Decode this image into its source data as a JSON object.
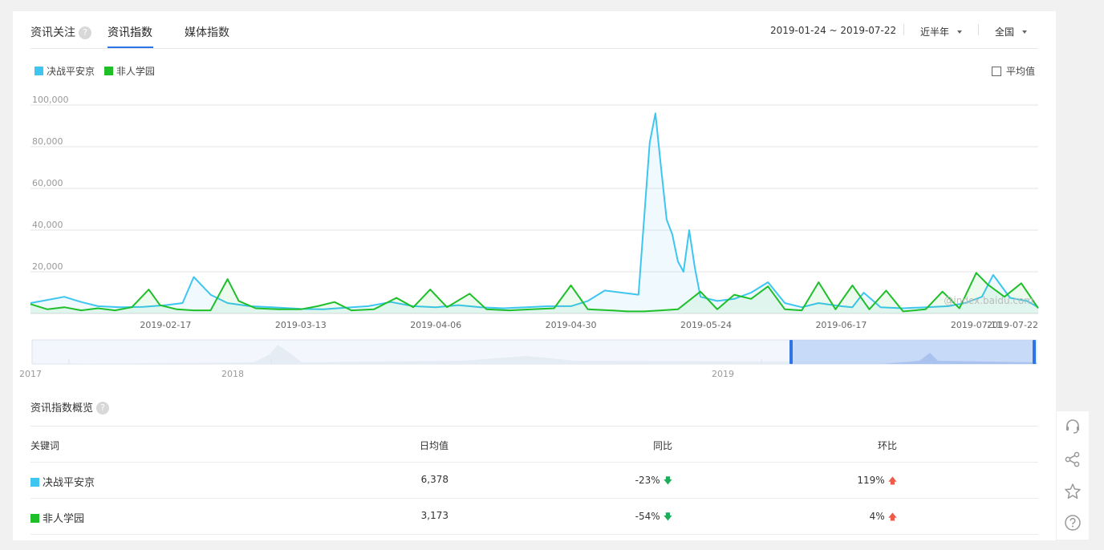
{
  "header": {
    "title": "资讯关注",
    "help_glyph": "?",
    "tabs": [
      {
        "label": "资讯指数",
        "active": true
      },
      {
        "label": "媒体指数",
        "active": false
      }
    ],
    "date_range": "2019-01-24 ~ 2019-07-22",
    "period": "近半年",
    "region": "全国"
  },
  "legend": {
    "series": [
      {
        "name": "决战平安京",
        "color": "#3ec5f0"
      },
      {
        "name": "非人学园",
        "color": "#1fbf2a"
      }
    ],
    "average_label": "平均值"
  },
  "watermark": "@index.baidu.com",
  "chart_data": {
    "type": "line",
    "x": [
      "2019-02-17",
      "2019-03-13",
      "2019-04-06",
      "2019-04-30",
      "2019-05-24",
      "2019-06-17",
      "2019-07-11",
      "2019-07-22"
    ],
    "ylim": [
      0,
      100000
    ],
    "yticks": [
      "100,000",
      "80,000",
      "60,000",
      "40,000",
      "20,000"
    ],
    "ytick_values": [
      100000,
      80000,
      60000,
      40000,
      20000
    ],
    "xstart": "2019-01-24",
    "xend": "2019-07-22",
    "series": [
      {
        "name": "决战平安京",
        "color": "#3ec5f0",
        "points": [
          [
            "2019-01-24",
            5000
          ],
          [
            "2019-01-27",
            6500
          ],
          [
            "2019-01-30",
            8000
          ],
          [
            "2019-02-02",
            5500
          ],
          [
            "2019-02-05",
            3500
          ],
          [
            "2019-02-09",
            3000
          ],
          [
            "2019-02-13",
            3200
          ],
          [
            "2019-02-17",
            4000
          ],
          [
            "2019-02-20",
            5000
          ],
          [
            "2019-02-22",
            17500
          ],
          [
            "2019-02-25",
            9000
          ],
          [
            "2019-02-28",
            5000
          ],
          [
            "2019-03-04",
            3500
          ],
          [
            "2019-03-08",
            3000
          ],
          [
            "2019-03-13",
            2200
          ],
          [
            "2019-03-17",
            2000
          ],
          [
            "2019-03-21",
            2800
          ],
          [
            "2019-03-25",
            3500
          ],
          [
            "2019-03-29",
            5500
          ],
          [
            "2019-04-02",
            3500
          ],
          [
            "2019-04-06",
            3000
          ],
          [
            "2019-04-10",
            4000
          ],
          [
            "2019-04-14",
            3000
          ],
          [
            "2019-04-18",
            2500
          ],
          [
            "2019-04-22",
            3000
          ],
          [
            "2019-04-26",
            3500
          ],
          [
            "2019-04-30",
            3500
          ],
          [
            "2019-05-03",
            6000
          ],
          [
            "2019-05-06",
            11000
          ],
          [
            "2019-05-09",
            10000
          ],
          [
            "2019-05-12",
            9000
          ],
          [
            "2019-05-14",
            82000
          ],
          [
            "2019-05-15",
            96000
          ],
          [
            "2019-05-16",
            70000
          ],
          [
            "2019-05-17",
            45000
          ],
          [
            "2019-05-18",
            38000
          ],
          [
            "2019-05-19",
            25000
          ],
          [
            "2019-05-20",
            20000
          ],
          [
            "2019-05-21",
            40000
          ],
          [
            "2019-05-22",
            22000
          ],
          [
            "2019-05-23",
            8000
          ],
          [
            "2019-05-26",
            6000
          ],
          [
            "2019-05-29",
            7000
          ],
          [
            "2019-06-01",
            10000
          ],
          [
            "2019-06-04",
            15000
          ],
          [
            "2019-06-07",
            5000
          ],
          [
            "2019-06-10",
            3000
          ],
          [
            "2019-06-13",
            5000
          ],
          [
            "2019-06-17",
            3500
          ],
          [
            "2019-06-19",
            3000
          ],
          [
            "2019-06-21",
            10000
          ],
          [
            "2019-06-24",
            3000
          ],
          [
            "2019-06-28",
            2500
          ],
          [
            "2019-07-02",
            3000
          ],
          [
            "2019-07-06",
            3500
          ],
          [
            "2019-07-09",
            5000
          ],
          [
            "2019-07-12",
            8000
          ],
          [
            "2019-07-14",
            18500
          ],
          [
            "2019-07-17",
            7500
          ],
          [
            "2019-07-20",
            6000
          ],
          [
            "2019-07-22",
            3000
          ]
        ]
      },
      {
        "name": "非人学园",
        "color": "#1fbf2a",
        "points": [
          [
            "2019-01-24",
            4500
          ],
          [
            "2019-01-27",
            2000
          ],
          [
            "2019-01-30",
            3000
          ],
          [
            "2019-02-02",
            1500
          ],
          [
            "2019-02-05",
            2500
          ],
          [
            "2019-02-08",
            1500
          ],
          [
            "2019-02-11",
            3000
          ],
          [
            "2019-02-14",
            11500
          ],
          [
            "2019-02-16",
            4000
          ],
          [
            "2019-02-19",
            2000
          ],
          [
            "2019-02-22",
            1500
          ],
          [
            "2019-02-25",
            1500
          ],
          [
            "2019-02-28",
            16500
          ],
          [
            "2019-03-02",
            6000
          ],
          [
            "2019-03-05",
            2500
          ],
          [
            "2019-03-09",
            2000
          ],
          [
            "2019-03-13",
            2000
          ],
          [
            "2019-03-16",
            3500
          ],
          [
            "2019-03-19",
            5500
          ],
          [
            "2019-03-22",
            1500
          ],
          [
            "2019-03-26",
            2000
          ],
          [
            "2019-03-30",
            7500
          ],
          [
            "2019-04-02",
            3000
          ],
          [
            "2019-04-05",
            11500
          ],
          [
            "2019-04-08",
            3000
          ],
          [
            "2019-04-12",
            9500
          ],
          [
            "2019-04-15",
            2000
          ],
          [
            "2019-04-19",
            1500
          ],
          [
            "2019-04-23",
            2000
          ],
          [
            "2019-04-27",
            2500
          ],
          [
            "2019-04-30",
            13500
          ],
          [
            "2019-05-03",
            2000
          ],
          [
            "2019-05-07",
            1500
          ],
          [
            "2019-05-10",
            1000
          ],
          [
            "2019-05-13",
            1000
          ],
          [
            "2019-05-16",
            1500
          ],
          [
            "2019-05-19",
            2000
          ],
          [
            "2019-05-23",
            10500
          ],
          [
            "2019-05-26",
            2000
          ],
          [
            "2019-05-29",
            9000
          ],
          [
            "2019-06-01",
            7000
          ],
          [
            "2019-06-04",
            13000
          ],
          [
            "2019-06-07",
            2000
          ],
          [
            "2019-06-10",
            1500
          ],
          [
            "2019-06-13",
            15000
          ],
          [
            "2019-06-16",
            2000
          ],
          [
            "2019-06-19",
            13500
          ],
          [
            "2019-06-22",
            2000
          ],
          [
            "2019-06-25",
            11000
          ],
          [
            "2019-06-28",
            1000
          ],
          [
            "2019-07-02",
            2000
          ],
          [
            "2019-07-05",
            10500
          ],
          [
            "2019-07-08",
            2500
          ],
          [
            "2019-07-11",
            19500
          ],
          [
            "2019-07-13",
            14000
          ],
          [
            "2019-07-16",
            8000
          ],
          [
            "2019-07-19",
            14500
          ],
          [
            "2019-07-22",
            2500
          ]
        ]
      }
    ]
  },
  "navigator": {
    "labels": [
      "2017",
      "2018",
      "2019"
    ]
  },
  "overview": {
    "title": "资讯指数概览",
    "columns": [
      "关键词",
      "日均值",
      "同比",
      "环比"
    ],
    "rows": [
      {
        "keyword": "决战平安京",
        "color": "#3ec5f0",
        "avg": "6,378",
        "yoy": "-23%",
        "mom": "119%"
      },
      {
        "keyword": "非人学园",
        "color": "#1fbf2a",
        "avg": "3,173",
        "yoy": "-54%",
        "mom": "4%"
      }
    ]
  },
  "sidebar": {
    "icons": [
      "headset-icon",
      "share-icon",
      "star-icon",
      "help-icon"
    ]
  }
}
